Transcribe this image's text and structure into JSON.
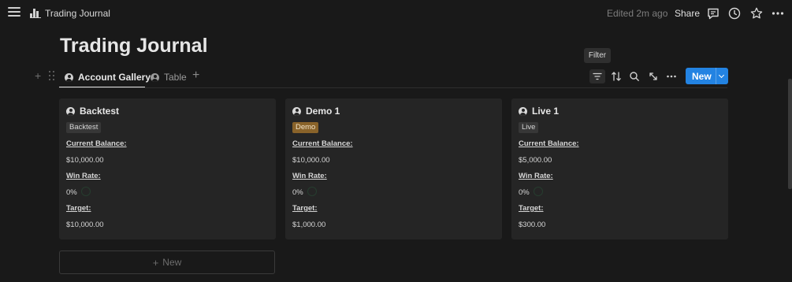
{
  "topbar": {
    "breadcrumb_title": "Trading Journal",
    "edited": "Edited 2m ago",
    "share": "Share",
    "icons": [
      "menu-icon",
      "chart-bar-icon",
      "comment-icon",
      "clock-icon",
      "star-icon",
      "more-icon"
    ]
  },
  "page": {
    "title": "Trading Journal"
  },
  "tooltip": {
    "text": "Filter"
  },
  "views": {
    "tabs": [
      {
        "label": "Account Gallery",
        "active": true
      },
      {
        "label": "Table",
        "active": false
      }
    ],
    "tools": [
      "filter-icon",
      "sort-icon",
      "search-icon",
      "expand-icon",
      "more-icon"
    ],
    "new_label": "New"
  },
  "cards": [
    {
      "title": "Backtest",
      "tag": "Backtest",
      "tag_bg": "#373737",
      "tag_color": "#d4d4d4",
      "balance_label": "Current Balance:",
      "balance": "$10,000.00",
      "winrate_label": "Win Rate:",
      "winrate": "0%",
      "target_label": "Target:",
      "target": "$10,000.00"
    },
    {
      "title": "Demo 1",
      "tag": "Demo",
      "tag_bg": "#89632a",
      "tag_color": "#f1e3c8",
      "balance_label": "Current Balance:",
      "balance": "$10,000.00",
      "winrate_label": "Win Rate:",
      "winrate": "0%",
      "target_label": "Target:",
      "target": "$1,000.00"
    },
    {
      "title": "Live 1",
      "tag": "Live",
      "tag_bg": "#373737",
      "tag_color": "#d4d4d4",
      "balance_label": "Current Balance:",
      "balance": "$5,000.00",
      "winrate_label": "Win Rate:",
      "winrate": "0%",
      "target_label": "Target:",
      "target": "$300.00"
    }
  ],
  "new_card": {
    "label": "New"
  },
  "colors": {
    "background": "#191919",
    "card": "#252525",
    "accent": "#2383e2"
  }
}
